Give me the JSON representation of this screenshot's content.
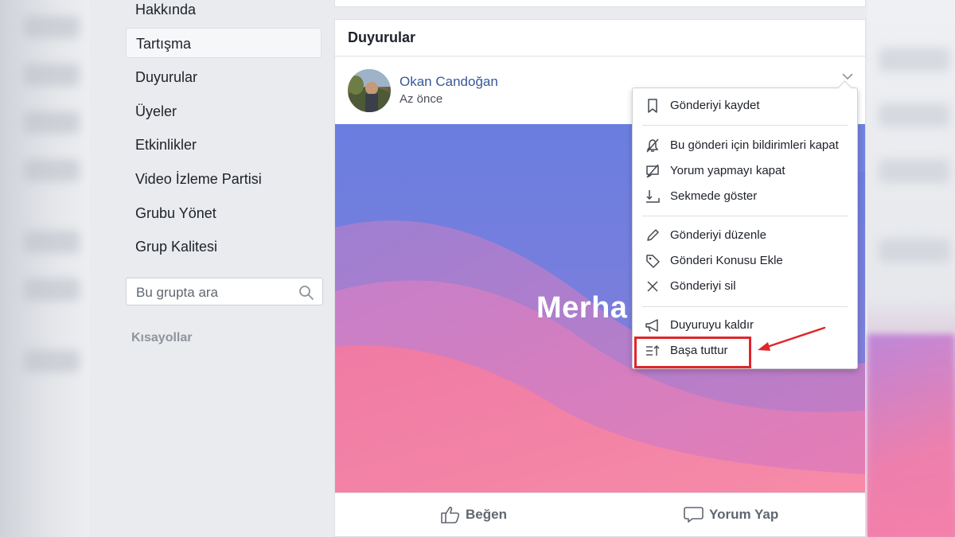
{
  "sidebar": {
    "items": [
      {
        "label": "Hakkında"
      },
      {
        "label": "Tartışma"
      },
      {
        "label": "Duyurular"
      },
      {
        "label": "Üyeler"
      },
      {
        "label": "Etkinlikler"
      },
      {
        "label": "Video İzleme Partisi"
      },
      {
        "label": "Grubu Yönet"
      },
      {
        "label": "Grup Kalitesi"
      }
    ],
    "active_item": "Tartışma",
    "search_placeholder": "Bu grupta ara",
    "shortcuts_label": "Kısayollar"
  },
  "feed": {
    "section_title": "Duyurular",
    "post": {
      "author": "Okan Candoğan",
      "timestamp": "Az önce",
      "image_text": "Merha",
      "like_label": "Beğen",
      "comment_label": "Yorum Yap"
    }
  },
  "menu": {
    "items": [
      {
        "label": "Gönderiyi kaydet",
        "icon": "bookmark-icon"
      },
      {
        "label": "Bu gönderi için bildirimleri kapat",
        "icon": "bell-off-icon"
      },
      {
        "label": "Yorum yapmayı kapat",
        "icon": "comment-off-icon"
      },
      {
        "label": "Sekmede göster",
        "icon": "arrow-down-tab-icon"
      },
      {
        "label": "Gönderiyi düzenle",
        "icon": "pencil-icon"
      },
      {
        "label": "Gönderi Konusu Ekle",
        "icon": "tag-icon"
      },
      {
        "label": "Gönderiyi sil",
        "icon": "close-icon"
      },
      {
        "label": "Duyuruyu kaldır",
        "icon": "megaphone-icon"
      },
      {
        "label": "Başa tuttur",
        "icon": "pin-top-icon"
      }
    ]
  },
  "colors": {
    "link_blue": "#385898",
    "annotation_red": "#e0252b",
    "image_top": "#6a7ee0",
    "image_bottom": "#f57fa6"
  }
}
